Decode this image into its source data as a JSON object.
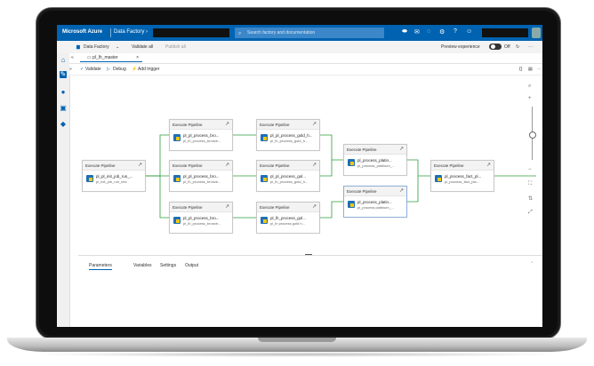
{
  "topbar": {
    "brand": "Microsoft Azure",
    "service": "Data Factory",
    "service_chevron": "›",
    "search_placeholder": "Search factory and documentation",
    "icons": [
      "notifications-icon",
      "feedback-icon",
      "bell-icon",
      "settings-icon",
      "help-icon",
      "people-icon"
    ]
  },
  "bar2": {
    "git_label": "Data Factory",
    "validate_all": "Validate all",
    "publish_all": "Publish all",
    "preview_label": "Preview experience",
    "preview_state": "Off"
  },
  "tab": {
    "label": "pl_lh_master",
    "close": "×"
  },
  "toolbar": {
    "validate": "Validate",
    "debug": "Debug",
    "add_trigger": "Add trigger"
  },
  "nodes": [
    {
      "id": "n0",
      "header": "Execute Pipeline",
      "name": "pl_pl_init_job_run_...",
      "sub": "pl_init_job_run_info"
    },
    {
      "id": "n1",
      "header": "Execute Pipeline",
      "name": "pl_pl_process_bro...",
      "sub": "pl_lh_process_bronze..."
    },
    {
      "id": "n2",
      "header": "Execute Pipeline",
      "name": "pl_pl_process_bro...",
      "sub": "pl_lh_process_bronze..."
    },
    {
      "id": "n3",
      "header": "Execute Pipeline",
      "name": "pl_pl_process_bro...",
      "sub": "pl_lh_process_bronze..."
    },
    {
      "id": "n4",
      "header": "Execute Pipeline",
      "name": "pl_pl_process_gold_h...",
      "sub": "pl_lh_process_gold_h..."
    },
    {
      "id": "n5",
      "header": "Execute Pipeline",
      "name": "pl_pl_process_gol...",
      "sub": "pl_lh_process_gold_h..."
    },
    {
      "id": "n6",
      "header": "Execute Pipeline",
      "name": "pl_lh_process_gol...",
      "sub": "pl_lh process gold h..."
    },
    {
      "id": "n7",
      "header": "Execute Pipeline",
      "name": "pl_process_platin...",
      "sub": "pl_process_platinum_..."
    },
    {
      "id": "n8",
      "header": "Execute Pipeline",
      "name": "pl_process_platin...",
      "sub": "pl_process platinum_..."
    },
    {
      "id": "n9",
      "header": "Execute Pipeline",
      "name": "pl_process_fact_pl...",
      "sub": "pl_process_fact_pla..."
    }
  ],
  "zoom": {
    "search": "⌕",
    "plus": "+",
    "minus": "−"
  },
  "panel": {
    "tabs": [
      "Parameters",
      "Variables",
      "Settings",
      "Output"
    ]
  }
}
